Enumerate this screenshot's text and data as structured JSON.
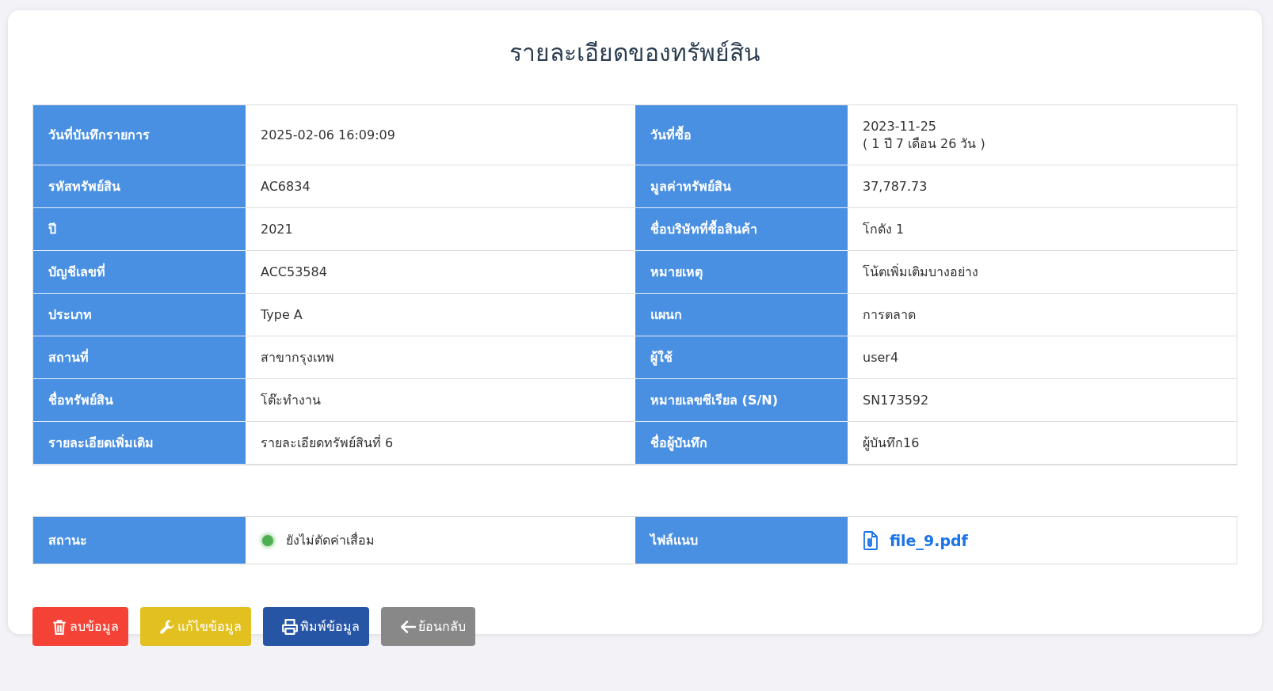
{
  "title": "รายละเอียดของทรัพย์สิน",
  "details": [
    {
      "label": "วันที่บันทึกรายการ",
      "value": [
        "2025-02-06 16:09:09"
      ]
    },
    {
      "label": "วันที่ซื้อ",
      "value": [
        "2023-11-25",
        "( 1 ปี 7 เดือน 26 วัน )"
      ]
    },
    {
      "label": "รหัสทรัพย์สิน",
      "value": [
        "AC6834"
      ]
    },
    {
      "label": "มูลค่าทรัพย์สิน",
      "value": [
        "37,787.73"
      ]
    },
    {
      "label": "ปี",
      "value": [
        "2021"
      ]
    },
    {
      "label": "ชื่อบริษัทที่ซื้อสินค้า",
      "value": [
        "โกดัง 1"
      ]
    },
    {
      "label": "บัญชีเลขที่",
      "value": [
        "ACC53584"
      ]
    },
    {
      "label": "หมายเหตุ",
      "value": [
        "โน้ตเพิ่มเติมบางอย่าง"
      ]
    },
    {
      "label": "ประเภท",
      "value": [
        "Type A"
      ]
    },
    {
      "label": "แผนก",
      "value": [
        "การตลาด"
      ]
    },
    {
      "label": "สถานที่",
      "value": [
        "สาขากรุงเทพ"
      ]
    },
    {
      "label": "ผู้ใช้",
      "value": [
        "user4"
      ]
    },
    {
      "label": "ชื่อทรัพย์สิน",
      "value": [
        "โต๊ะทำงาน"
      ]
    },
    {
      "label": "หมายเลขซีเรียล (S/N)",
      "value": [
        "SN173592"
      ]
    },
    {
      "label": "รายละเอียดเพิ่มเติม",
      "value": [
        "รายละเอียดทรัพย์สินที่ 6"
      ]
    },
    {
      "label": "ชื่อผู้บันทึก",
      "value": [
        "ผู้บันทึก16"
      ]
    }
  ],
  "status": {
    "label": "สถานะ",
    "text": "ยังไม่ตัดค่าเสื่อม",
    "color": "#4caf50"
  },
  "attachment": {
    "label": "ไฟล์แนบ",
    "file": "file_9.pdf"
  },
  "buttons": [
    {
      "kind": "delete",
      "label": "ลบข้อมูล"
    },
    {
      "kind": "edit",
      "label": "แก้ไขข้อมูล"
    },
    {
      "kind": "print",
      "label": "พิมพ์ข้อมูล"
    },
    {
      "kind": "back",
      "label": "ย้อนกลับ"
    }
  ]
}
